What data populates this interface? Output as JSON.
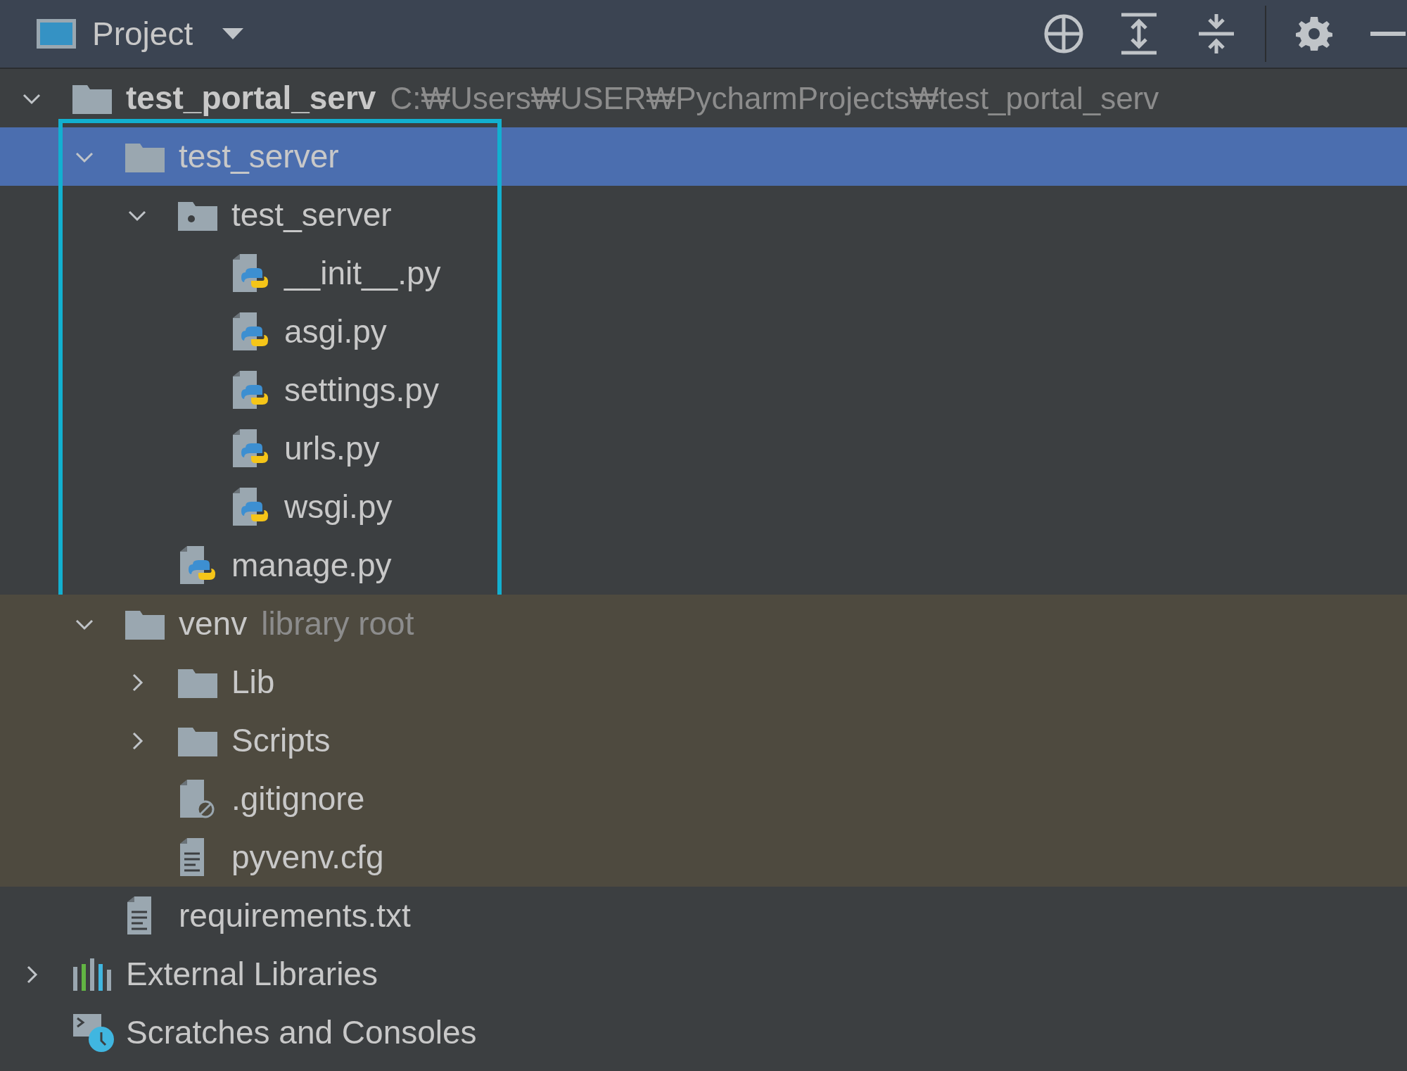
{
  "header": {
    "title": "Project"
  },
  "tree": [
    {
      "name": "test_portal_serv",
      "path": "C:₩Users₩USER₩PycharmProjects₩test_portal_serv",
      "kind": "folder",
      "bold": true,
      "expanded": true,
      "selected": false,
      "framed": false,
      "library": false,
      "children": [
        {
          "name": "test_server",
          "kind": "folder",
          "expanded": true,
          "selected": true,
          "framed": true,
          "library": false,
          "children": [
            {
              "name": "test_server",
              "kind": "package",
              "expanded": true,
              "selected": false,
              "framed": true,
              "library": false,
              "children": [
                {
                  "name": "__init__.py",
                  "kind": "python",
                  "selected": false,
                  "framed": true,
                  "library": false
                },
                {
                  "name": "asgi.py",
                  "kind": "python",
                  "selected": false,
                  "framed": true,
                  "library": false
                },
                {
                  "name": "settings.py",
                  "kind": "python",
                  "selected": false,
                  "framed": true,
                  "library": false
                },
                {
                  "name": "urls.py",
                  "kind": "python",
                  "selected": false,
                  "framed": true,
                  "library": false
                },
                {
                  "name": "wsgi.py",
                  "kind": "python",
                  "selected": false,
                  "framed": true,
                  "library": false
                }
              ]
            },
            {
              "name": "manage.py",
              "kind": "python",
              "selected": false,
              "framed": true,
              "library": false
            }
          ]
        },
        {
          "name": "venv",
          "note": "library root",
          "kind": "folder",
          "expanded": true,
          "selected": false,
          "framed": false,
          "library": true,
          "children": [
            {
              "name": "Lib",
              "kind": "folder",
              "expanded": false,
              "selected": false,
              "framed": false,
              "library": true
            },
            {
              "name": "Scripts",
              "kind": "folder",
              "expanded": false,
              "selected": false,
              "framed": false,
              "library": true
            },
            {
              "name": ".gitignore",
              "kind": "ignore",
              "selected": false,
              "framed": false,
              "library": true
            },
            {
              "name": "pyvenv.cfg",
              "kind": "text",
              "selected": false,
              "framed": false,
              "library": true
            }
          ]
        },
        {
          "name": "requirements.txt",
          "kind": "text",
          "selected": false,
          "framed": false,
          "library": false
        }
      ]
    },
    {
      "name": "External Libraries",
      "kind": "libraries",
      "expanded": false,
      "selected": false,
      "framed": false,
      "library": false
    },
    {
      "name": "Scratches and Consoles",
      "kind": "scratches",
      "selected": false,
      "framed": false,
      "library": false
    }
  ]
}
